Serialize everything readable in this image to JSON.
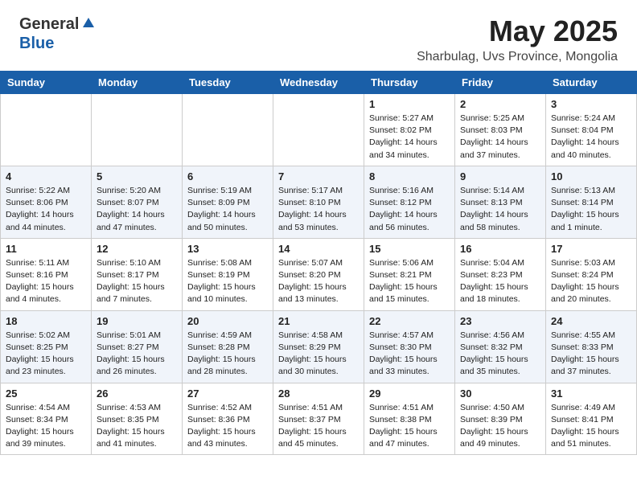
{
  "header": {
    "logo_general": "General",
    "logo_blue": "Blue",
    "title": "May 2025",
    "location": "Sharbulag, Uvs Province, Mongolia"
  },
  "days_of_week": [
    "Sunday",
    "Monday",
    "Tuesday",
    "Wednesday",
    "Thursday",
    "Friday",
    "Saturday"
  ],
  "weeks": [
    [
      {
        "day": "",
        "info": ""
      },
      {
        "day": "",
        "info": ""
      },
      {
        "day": "",
        "info": ""
      },
      {
        "day": "",
        "info": ""
      },
      {
        "day": "1",
        "info": "Sunrise: 5:27 AM\nSunset: 8:02 PM\nDaylight: 14 hours\nand 34 minutes."
      },
      {
        "day": "2",
        "info": "Sunrise: 5:25 AM\nSunset: 8:03 PM\nDaylight: 14 hours\nand 37 minutes."
      },
      {
        "day": "3",
        "info": "Sunrise: 5:24 AM\nSunset: 8:04 PM\nDaylight: 14 hours\nand 40 minutes."
      }
    ],
    [
      {
        "day": "4",
        "info": "Sunrise: 5:22 AM\nSunset: 8:06 PM\nDaylight: 14 hours\nand 44 minutes."
      },
      {
        "day": "5",
        "info": "Sunrise: 5:20 AM\nSunset: 8:07 PM\nDaylight: 14 hours\nand 47 minutes."
      },
      {
        "day": "6",
        "info": "Sunrise: 5:19 AM\nSunset: 8:09 PM\nDaylight: 14 hours\nand 50 minutes."
      },
      {
        "day": "7",
        "info": "Sunrise: 5:17 AM\nSunset: 8:10 PM\nDaylight: 14 hours\nand 53 minutes."
      },
      {
        "day": "8",
        "info": "Sunrise: 5:16 AM\nSunset: 8:12 PM\nDaylight: 14 hours\nand 56 minutes."
      },
      {
        "day": "9",
        "info": "Sunrise: 5:14 AM\nSunset: 8:13 PM\nDaylight: 14 hours\nand 58 minutes."
      },
      {
        "day": "10",
        "info": "Sunrise: 5:13 AM\nSunset: 8:14 PM\nDaylight: 15 hours\nand 1 minute."
      }
    ],
    [
      {
        "day": "11",
        "info": "Sunrise: 5:11 AM\nSunset: 8:16 PM\nDaylight: 15 hours\nand 4 minutes."
      },
      {
        "day": "12",
        "info": "Sunrise: 5:10 AM\nSunset: 8:17 PM\nDaylight: 15 hours\nand 7 minutes."
      },
      {
        "day": "13",
        "info": "Sunrise: 5:08 AM\nSunset: 8:19 PM\nDaylight: 15 hours\nand 10 minutes."
      },
      {
        "day": "14",
        "info": "Sunrise: 5:07 AM\nSunset: 8:20 PM\nDaylight: 15 hours\nand 13 minutes."
      },
      {
        "day": "15",
        "info": "Sunrise: 5:06 AM\nSunset: 8:21 PM\nDaylight: 15 hours\nand 15 minutes."
      },
      {
        "day": "16",
        "info": "Sunrise: 5:04 AM\nSunset: 8:23 PM\nDaylight: 15 hours\nand 18 minutes."
      },
      {
        "day": "17",
        "info": "Sunrise: 5:03 AM\nSunset: 8:24 PM\nDaylight: 15 hours\nand 20 minutes."
      }
    ],
    [
      {
        "day": "18",
        "info": "Sunrise: 5:02 AM\nSunset: 8:25 PM\nDaylight: 15 hours\nand 23 minutes."
      },
      {
        "day": "19",
        "info": "Sunrise: 5:01 AM\nSunset: 8:27 PM\nDaylight: 15 hours\nand 26 minutes."
      },
      {
        "day": "20",
        "info": "Sunrise: 4:59 AM\nSunset: 8:28 PM\nDaylight: 15 hours\nand 28 minutes."
      },
      {
        "day": "21",
        "info": "Sunrise: 4:58 AM\nSunset: 8:29 PM\nDaylight: 15 hours\nand 30 minutes."
      },
      {
        "day": "22",
        "info": "Sunrise: 4:57 AM\nSunset: 8:30 PM\nDaylight: 15 hours\nand 33 minutes."
      },
      {
        "day": "23",
        "info": "Sunrise: 4:56 AM\nSunset: 8:32 PM\nDaylight: 15 hours\nand 35 minutes."
      },
      {
        "day": "24",
        "info": "Sunrise: 4:55 AM\nSunset: 8:33 PM\nDaylight: 15 hours\nand 37 minutes."
      }
    ],
    [
      {
        "day": "25",
        "info": "Sunrise: 4:54 AM\nSunset: 8:34 PM\nDaylight: 15 hours\nand 39 minutes."
      },
      {
        "day": "26",
        "info": "Sunrise: 4:53 AM\nSunset: 8:35 PM\nDaylight: 15 hours\nand 41 minutes."
      },
      {
        "day": "27",
        "info": "Sunrise: 4:52 AM\nSunset: 8:36 PM\nDaylight: 15 hours\nand 43 minutes."
      },
      {
        "day": "28",
        "info": "Sunrise: 4:51 AM\nSunset: 8:37 PM\nDaylight: 15 hours\nand 45 minutes."
      },
      {
        "day": "29",
        "info": "Sunrise: 4:51 AM\nSunset: 8:38 PM\nDaylight: 15 hours\nand 47 minutes."
      },
      {
        "day": "30",
        "info": "Sunrise: 4:50 AM\nSunset: 8:39 PM\nDaylight: 15 hours\nand 49 minutes."
      },
      {
        "day": "31",
        "info": "Sunrise: 4:49 AM\nSunset: 8:41 PM\nDaylight: 15 hours\nand 51 minutes."
      }
    ]
  ]
}
